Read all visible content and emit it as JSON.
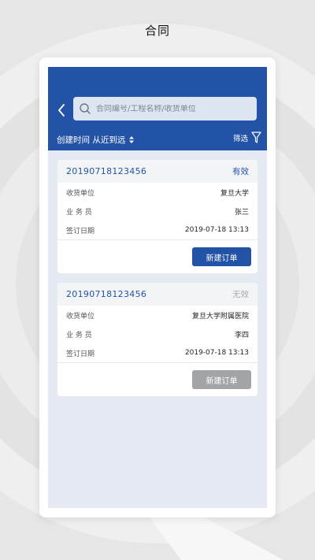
{
  "promo": {
    "title": "合同"
  },
  "search": {
    "placeholder": "合同编号/工程名称/收货单位"
  },
  "sort": {
    "label": "创建时间 从近到远"
  },
  "filter": {
    "label": "筛选"
  },
  "contracts": [
    {
      "number": "20190718123456",
      "status": "有效",
      "receiver_label": "收货单位",
      "receiver": "复旦大学",
      "salesperson_label": "业 务 员",
      "salesperson": "张三",
      "signed_label": "签订日期",
      "signed": "2019-07-18 13:13",
      "button": "新建订单"
    },
    {
      "number": "20190718123456",
      "status": "无效",
      "receiver_label": "收货单位",
      "receiver": "复旦大学附属医院",
      "salesperson_label": "业 务 员",
      "salesperson": "李四",
      "signed_label": "签订日期",
      "signed": "2019-07-18 13:13",
      "button": "新建订单"
    }
  ],
  "colors": {
    "brand": "#2353a6",
    "inactive": "#a7a9ad",
    "disabled_button": "#a3a4a6"
  }
}
